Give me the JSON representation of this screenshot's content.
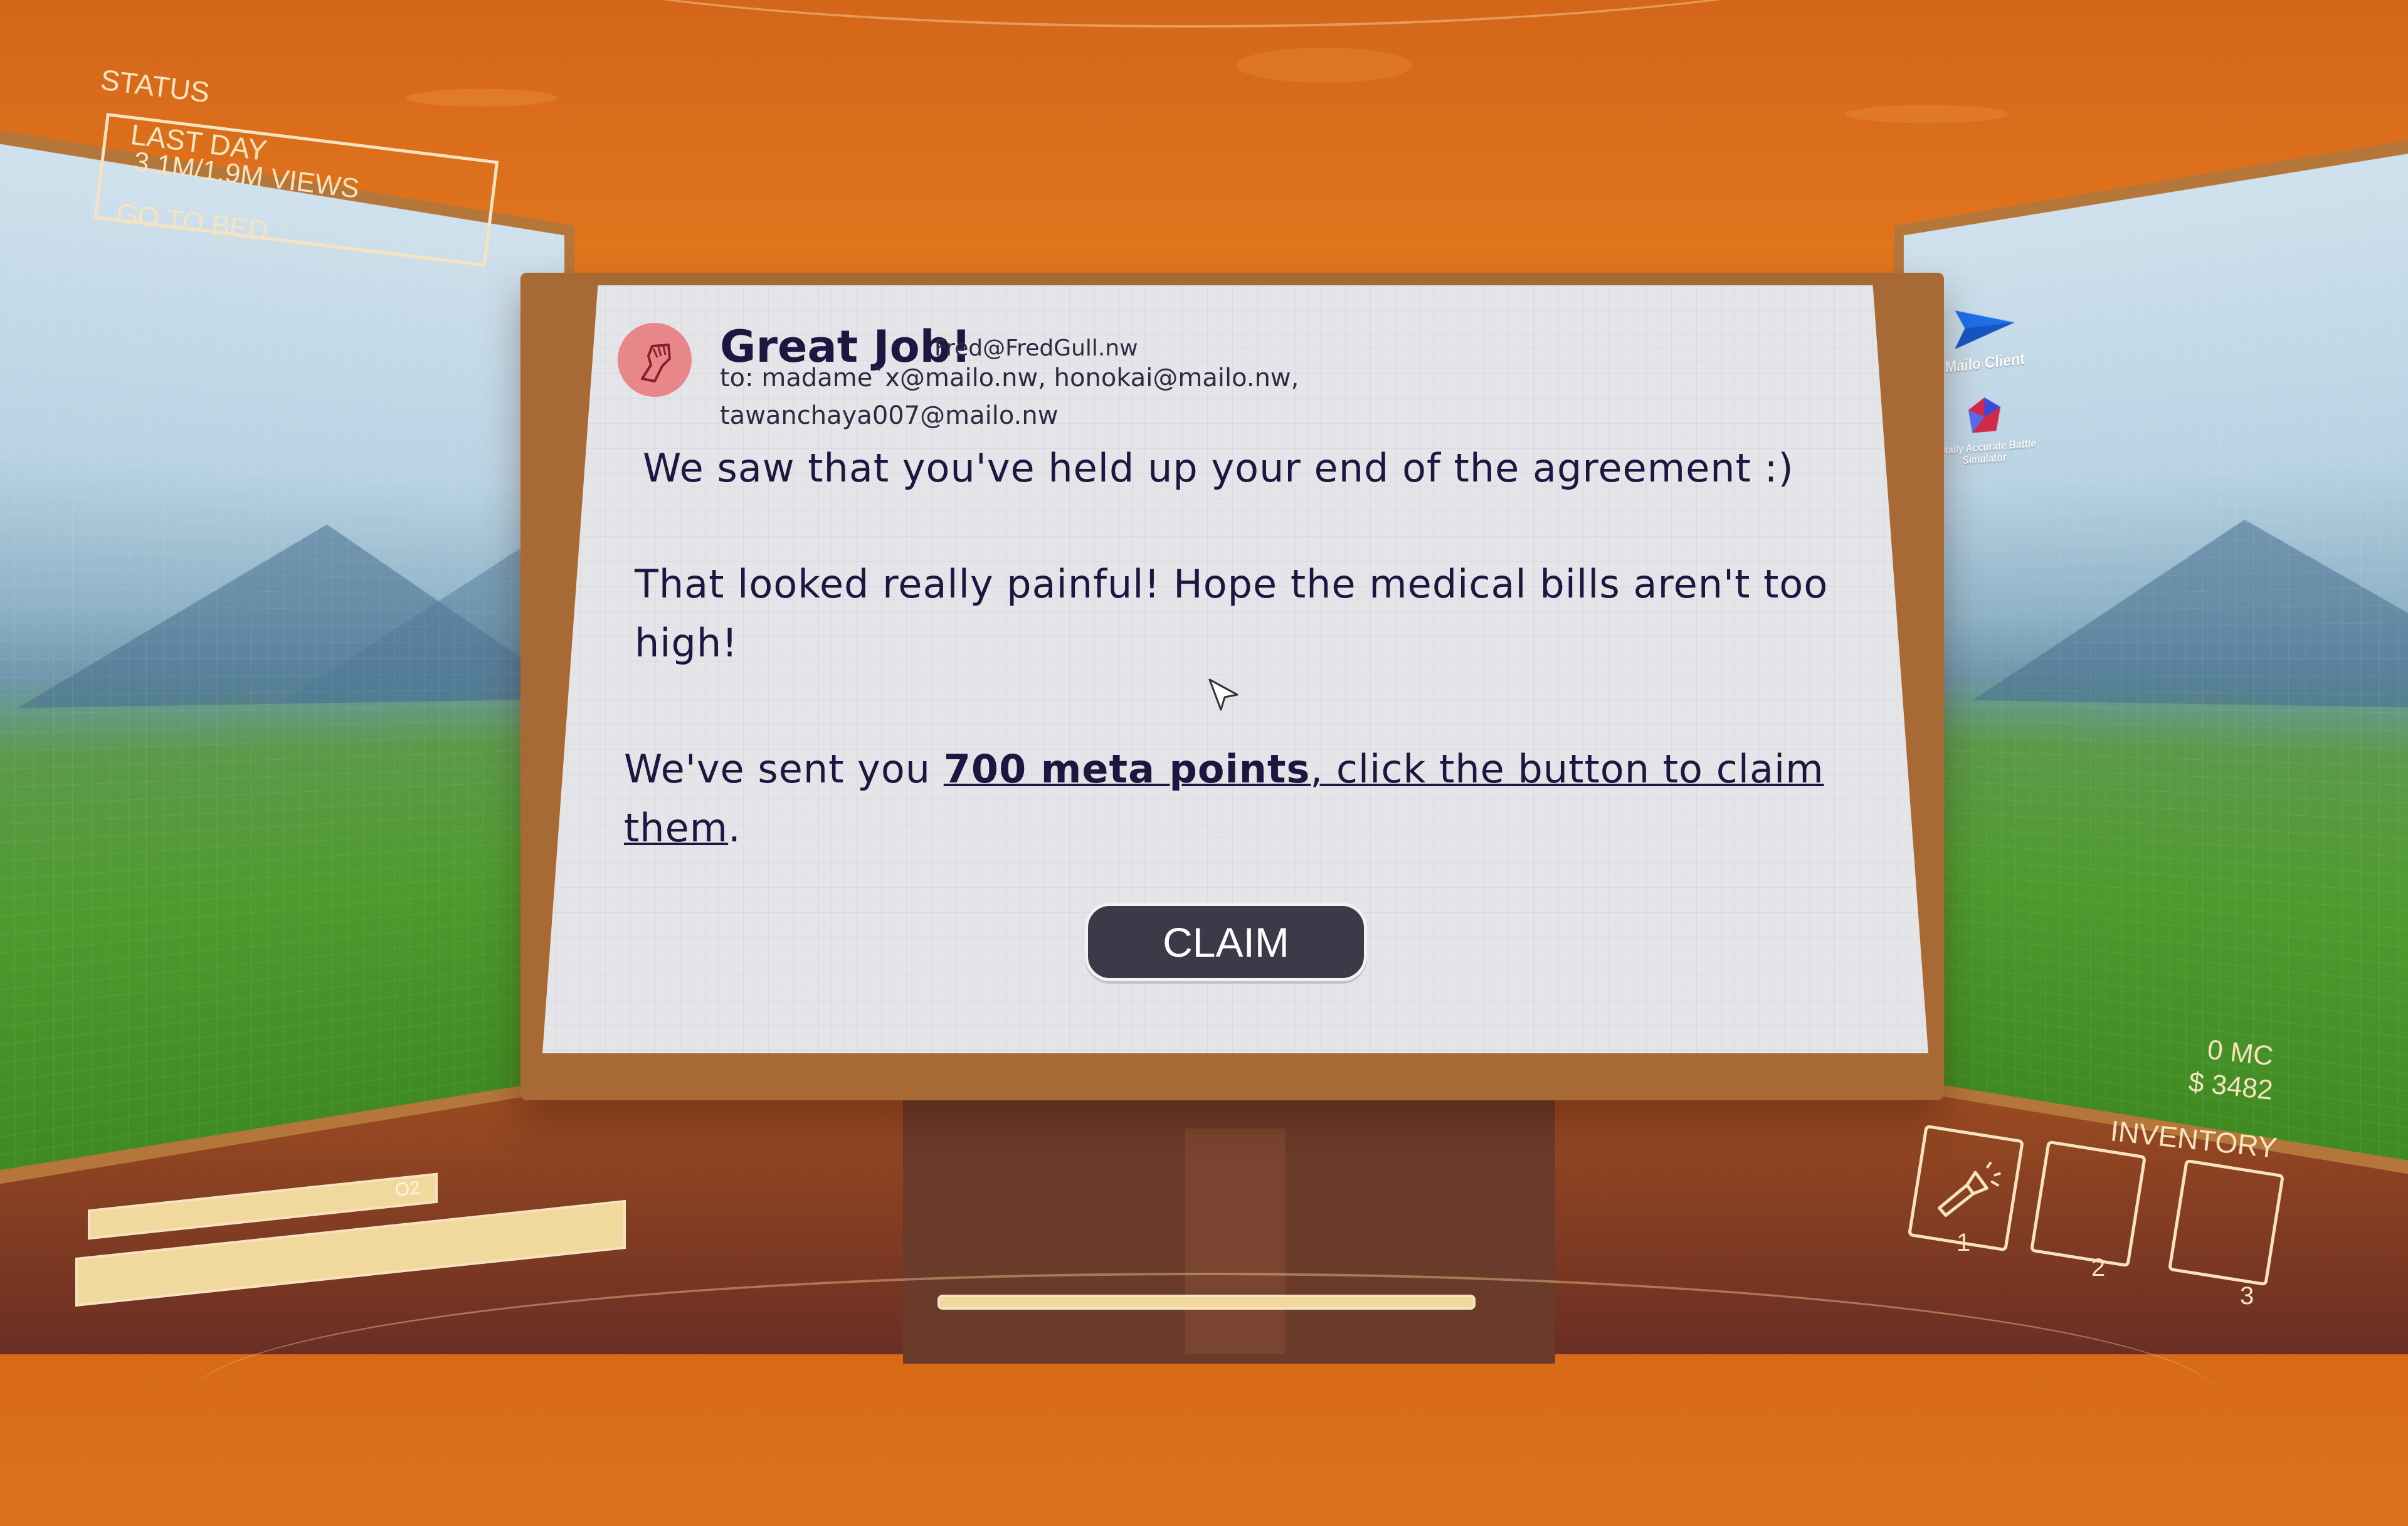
{
  "hud": {
    "status_label": "STATUS",
    "day_label": "LAST DAY",
    "views_label": "3.1M/1.9M VIEWS",
    "go_to_bed_label": "GO TO BED",
    "o2_label": "O2",
    "currency_mc": "0 MC",
    "money": "$ 3482",
    "inventory_label": "INVENTORY",
    "inventory_slots": [
      {
        "number": "1",
        "icon": "flashlight-icon"
      },
      {
        "number": "2",
        "icon": ""
      },
      {
        "number": "3",
        "icon": ""
      }
    ]
  },
  "desktop": {
    "icons": [
      {
        "label": "Mailo Client",
        "icon": "paper-plane-icon"
      },
      {
        "label": "Totally Accurate Battle Simulator",
        "icon": "gem-icon"
      }
    ]
  },
  "email": {
    "subject": "Great Job!",
    "from": "Fred@FredGull.nw",
    "to_line1": "to: madame`x@mailo.nw, honokai@mailo.nw,",
    "to_line2": "tawanchaya007@mailo.nw",
    "body_p1": "We saw that you've held up your end of the agreement :)",
    "body_p2": "That looked really painful! Hope the medical bills aren't too high!",
    "body_p3_prefix": "We've sent you ",
    "body_p3_bold": "700 meta points",
    "body_p3_link": ", click the button to claim them",
    "body_p3_suffix": ".",
    "claim_label": "CLAIM"
  },
  "colors": {
    "wall": "#e2761e",
    "hud": "#f6e3bf",
    "screen": "#e4e5e9",
    "text": "#1e1640",
    "button": "#3b3a48",
    "avatar": "#e8878a"
  }
}
